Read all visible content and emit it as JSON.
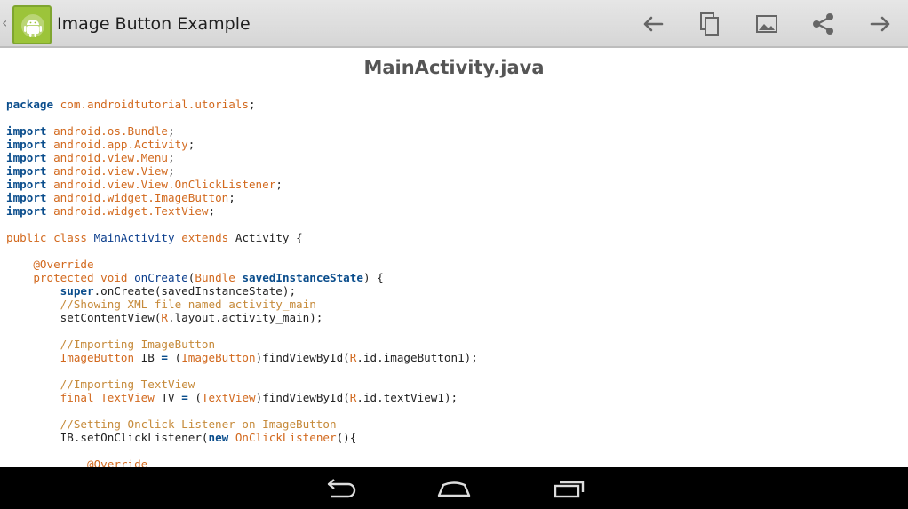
{
  "actionbar": {
    "title": "Image Button Example",
    "actions": [
      "back-arrow-icon",
      "copy-icon",
      "picture-icon",
      "share-icon",
      "forward-arrow-icon"
    ]
  },
  "content": {
    "file_title": "MainActivity.java"
  },
  "code": {
    "l0a": "package",
    "l0b": "com.androidtutorial.utorials",
    "l0c": ";",
    "imp": "import",
    "i1": "android.os.Bundle",
    "i2": "android.app.Activity",
    "i3": "android.view.Menu",
    "i4": "android.view.View",
    "i5": "android.view.View.OnClickListener",
    "i6": "android.widget.ImageButton",
    "i7": "android.widget.TextView",
    "semi": ";",
    "cls_public": "public class",
    "cls_name": "MainActivity",
    "cls_extends": "extends",
    "cls_rest": "Activity {",
    "override": "@Override",
    "m_prot": "protected void",
    "m_name": "onCreate",
    "m_open": "(",
    "m_bundle": "Bundle",
    "m_param": "savedInstanceState",
    "m_close": ") {",
    "super_kw": "super",
    "super_rest": ".onCreate(savedInstanceState);",
    "c1": "//Showing XML file named activity_main",
    "scv_a": "setContentView(",
    "R": "R",
    "scv_b": ".layout.activity_main);",
    "c2": "//Importing ImageButton",
    "ib_type": "ImageButton",
    "ib_var": " IB ",
    "eq": "=",
    "paren_open": " (",
    "fv1_rest": ")findViewById(",
    "fv1_end": ".id.imageButton1);",
    "c3": "//Importing TextView",
    "final_kw": "final",
    "tv_type": "TextView",
    "tv_var": " TV ",
    "fv2_end": ".id.textView1);",
    "c4": "//Setting Onclick Listener on ImageButton",
    "ibset": "IB.setOnClickListener(",
    "new_kw": "new",
    "ocl": "OnClickListener",
    "ocl_end": "(){",
    "override2": "@Override"
  },
  "navbar": {
    "buttons": [
      "back-nav-icon",
      "home-nav-icon",
      "recent-apps-icon"
    ]
  }
}
